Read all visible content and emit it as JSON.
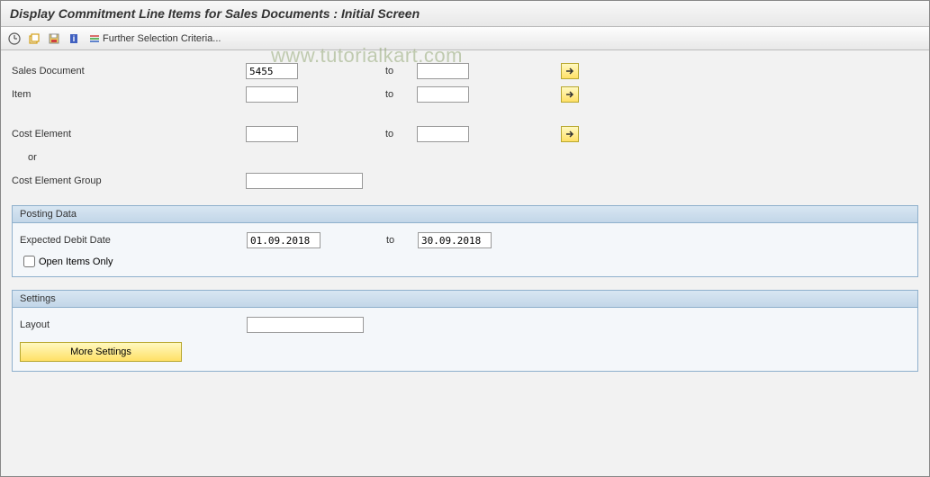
{
  "header": {
    "title": "Display Commitment Line Items for Sales Documents : Initial Screen"
  },
  "toolbar": {
    "further_selection": "Further Selection Criteria..."
  },
  "watermark": "www.tutorialkart.com",
  "fields": {
    "sales_document": {
      "label": "Sales Document",
      "from": "5455",
      "to_label": "to",
      "to": ""
    },
    "item": {
      "label": "Item",
      "from": "",
      "to_label": "to",
      "to": ""
    },
    "cost_element": {
      "label": "Cost Element",
      "from": "",
      "to_label": "to",
      "to": ""
    },
    "or_label": "or",
    "cost_element_group": {
      "label": "Cost Element Group",
      "value": ""
    }
  },
  "posting_data": {
    "title": "Posting Data",
    "expected_debit_date": {
      "label": "Expected Debit Date",
      "from": "01.09.2018",
      "to_label": "to",
      "to": "30.09.2018"
    },
    "open_items_label": "Open Items Only"
  },
  "settings": {
    "title": "Settings",
    "layout": {
      "label": "Layout",
      "value": ""
    },
    "more_settings": "More Settings"
  }
}
